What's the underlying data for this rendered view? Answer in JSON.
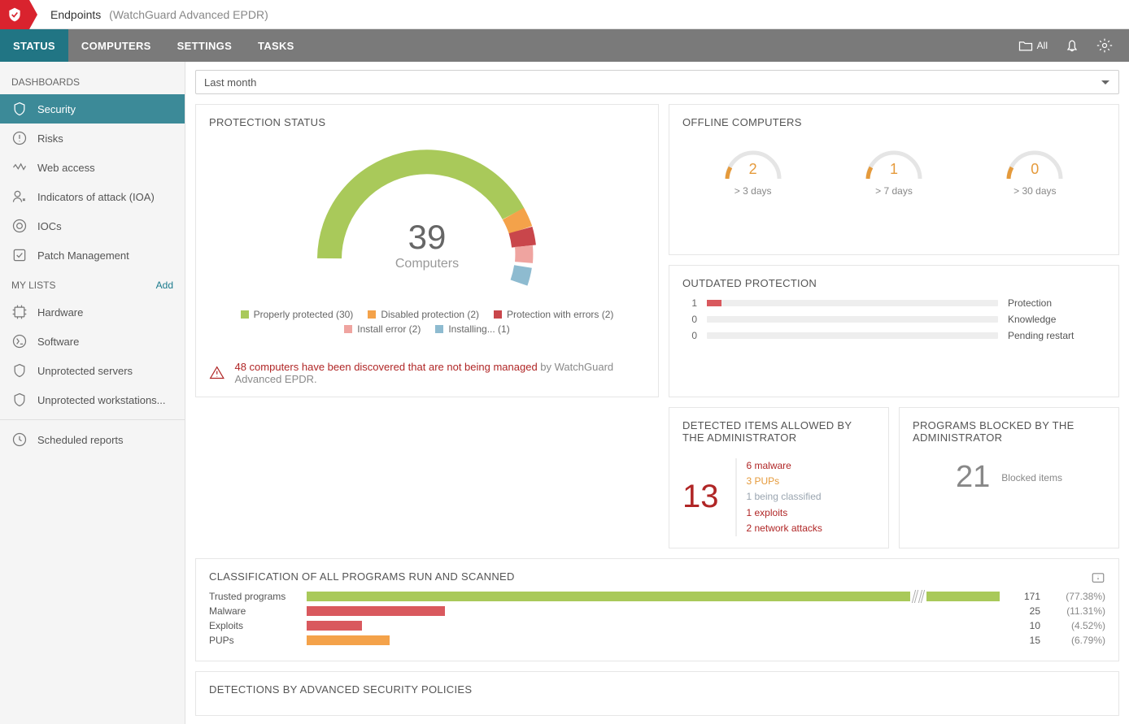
{
  "header": {
    "app": "Endpoints",
    "product": "(WatchGuard Advanced EPDR)"
  },
  "nav": {
    "status": "STATUS",
    "computers": "COMPUTERS",
    "settings": "SETTINGS",
    "tasks": "TASKS",
    "all": "All"
  },
  "sidebar": {
    "dash_title": "DASHBOARDS",
    "items": [
      {
        "label": "Security"
      },
      {
        "label": "Risks"
      },
      {
        "label": "Web access"
      },
      {
        "label": "Indicators of attack (IOA)"
      },
      {
        "label": "IOCs"
      },
      {
        "label": "Patch Management"
      }
    ],
    "lists_title": "MY LISTS",
    "add": "Add",
    "lists": [
      {
        "label": "Hardware"
      },
      {
        "label": "Software"
      },
      {
        "label": "Unprotected servers"
      },
      {
        "label": "Unprotected workstations..."
      }
    ],
    "reports": "Scheduled reports"
  },
  "time_selected": "Last month",
  "protection": {
    "title": "PROTECTION STATUS",
    "count": "39",
    "count_label": "Computers",
    "legend": [
      {
        "label": "Properly protected (30)",
        "color": "#a9c95a"
      },
      {
        "label": "Disabled protection (2)",
        "color": "#f4a24a"
      },
      {
        "label": "Protection with errors (2)",
        "color": "#c9464b"
      },
      {
        "label": "Install error (2)",
        "color": "#efa4a0"
      },
      {
        "label": "Installing... (1)",
        "color": "#8ebbd0"
      }
    ],
    "alert_main": "48 computers have been discovered that are not being managed",
    "alert_tail": " by WatchGuard Advanced EPDR."
  },
  "offline": {
    "title": "OFFLINE COMPUTERS",
    "items": [
      {
        "value": "2",
        "label": "> 3 days"
      },
      {
        "value": "1",
        "label": "> 7 days"
      },
      {
        "value": "0",
        "label": "> 30 days"
      }
    ]
  },
  "outdated": {
    "title": "OUTDATED PROTECTION",
    "rows": [
      {
        "value": "1",
        "label": "Protection",
        "pct": 5
      },
      {
        "value": "0",
        "label": "Knowledge",
        "pct": 0
      },
      {
        "value": "0",
        "label": "Pending restart",
        "pct": 0
      }
    ]
  },
  "detected": {
    "title": "DETECTED ITEMS ALLOWED BY THE ADMINISTRATOR",
    "count": "13",
    "lines": [
      {
        "text": "6 malware",
        "color": "#b02626"
      },
      {
        "text": "3 PUPs",
        "color": "#e59a3b"
      },
      {
        "text": "1 being classified",
        "color": "#9aa5b0"
      },
      {
        "text": "1 exploits",
        "color": "#b02626"
      },
      {
        "text": "2 network attacks",
        "color": "#b02626"
      }
    ]
  },
  "blocked": {
    "title": "PROGRAMS BLOCKED BY THE ADMINISTRATOR",
    "count": "21",
    "label": "Blocked items"
  },
  "classification": {
    "title": "CLASSIFICATION OF ALL PROGRAMS RUN AND SCANNED",
    "rows": [
      {
        "label": "Trusted programs",
        "count": "171",
        "pct": "(77.38%)",
        "color": "#a9c95a",
        "width": 100,
        "break": true
      },
      {
        "label": "Malware",
        "count": "25",
        "pct": "(11.31%)",
        "color": "#d9595e",
        "width": 20
      },
      {
        "label": "Exploits",
        "count": "10",
        "pct": "(4.52%)",
        "color": "#d9595e",
        "width": 8
      },
      {
        "label": "PUPs",
        "count": "15",
        "pct": "(6.79%)",
        "color": "#f4a24a",
        "width": 12
      }
    ]
  },
  "advsec": {
    "title": "DETECTIONS BY ADVANCED SECURITY POLICIES"
  }
}
